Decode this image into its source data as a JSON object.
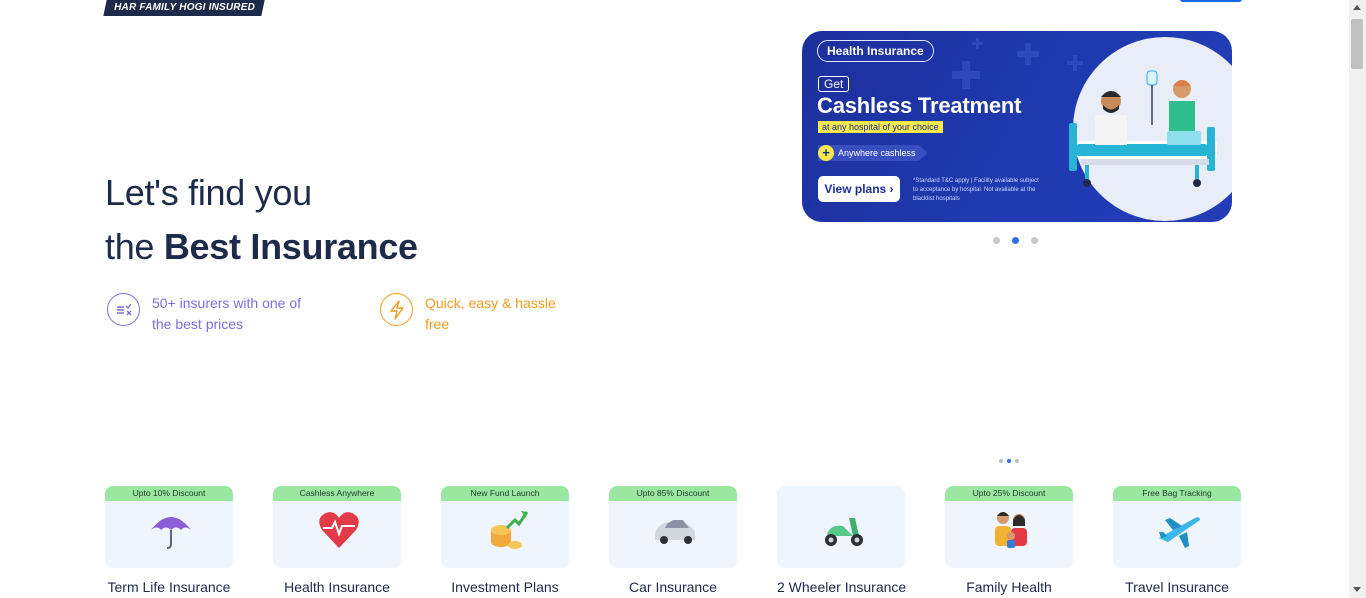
{
  "header": {
    "tagline": "HAR FAMILY HOGI INSURED"
  },
  "hero": {
    "line1": "Let's find you",
    "line2_prefix": "the",
    "line2_bold": "Best Insurance",
    "features": [
      {
        "icon": "compare-prices-icon",
        "text": "50+ insurers with one of the best prices",
        "color": "#7b6fe0"
      },
      {
        "icon": "lightning-icon",
        "text": "Quick, easy & hassle free",
        "color": "#f29b1d"
      }
    ]
  },
  "banner": {
    "pill": "Health Insurance",
    "get": "Get",
    "headline": "Cashless Treatment",
    "subline": "at any hospital of your choice",
    "tag": "Anywhere cashless",
    "cta": "View plans ›",
    "fine_print": "*Standard T&C apply | Facility available subject to acceptance by hospital. Not available at the blacklist hospitals",
    "illustration": "hospital-bed-doctor-illustration",
    "accent": "#1d2f9c",
    "highlight": "#f5e84a"
  },
  "carousel": {
    "slides": 3,
    "active": 1
  },
  "products_carousel": {
    "slides": 3,
    "active": 1
  },
  "products": [
    {
      "badge": "Upto 10% Discount",
      "name": "Term Life Insurance",
      "icon": "umbrella-icon"
    },
    {
      "badge": "Cashless Anywhere",
      "name": "Health Insurance",
      "icon": "heart-pulse-icon"
    },
    {
      "badge": "New Fund Launch",
      "name": "Investment Plans",
      "icon": "coins-growth-icon"
    },
    {
      "badge": "Upto 85% Discount",
      "name": "Car Insurance",
      "icon": "car-icon"
    },
    {
      "badge": "",
      "name": "2 Wheeler Insurance",
      "icon": "scooter-icon"
    },
    {
      "badge": "Upto 25% Discount",
      "name": "Family Health",
      "icon": "family-icon"
    },
    {
      "badge": "Free Bag Tracking",
      "name": "Travel Insurance",
      "icon": "airplane-icon"
    }
  ]
}
